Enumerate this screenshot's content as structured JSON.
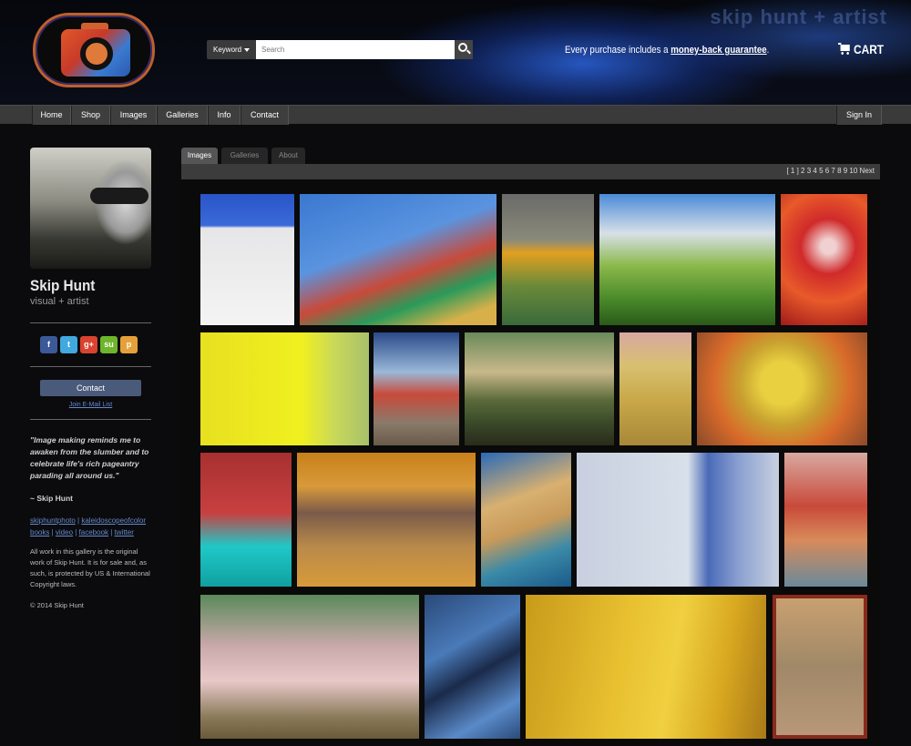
{
  "header": {
    "brand_watermark": "skip hunt + artist",
    "search": {
      "scope_label": "Keyword",
      "placeholder": "Search"
    },
    "promo_prefix": "Every purchase includes a",
    "promo_link": "money-back guarantee",
    "promo_suffix": ".",
    "cart_label": "CART"
  },
  "nav": {
    "items": [
      "Home",
      "Shop",
      "Images",
      "Galleries",
      "Info",
      "Contact"
    ],
    "signin": "Sign In"
  },
  "sidebar": {
    "name": "Skip Hunt",
    "subtitle": "visual + artist",
    "social": [
      "f",
      "t",
      "g+",
      "su",
      "p"
    ],
    "contact_label": "Contact",
    "join_label": "Join E-Mail List",
    "quote": "\"Image making reminds me to awaken from the slumber and to celebrate life's rich pageantry parading all around us.\"",
    "signature": "~ Skip Hunt",
    "links": {
      "l1": "skiphuntphoto",
      "sep1": " | ",
      "l2": "kaleidoscopeofcolor books",
      "sep2": " | ",
      "l3": "video",
      "sep3": " | ",
      "l4": "facebook",
      "sep4": " | ",
      "l5": "twitter"
    },
    "notice": "All work in this gallery is the original work of Skip Hunt. It is for sale and, as such, is protected by US & International Copyright laws.",
    "copyright": "© 2014 Skip Hunt"
  },
  "tabs": [
    "Images",
    "Galleries",
    "About"
  ],
  "pager": "[ 1 ] 2 3 4 5 6 7 8 9 10 Next",
  "colors": {
    "facebook": "#3b5998",
    "twitter": "#41a9e0",
    "googleplus": "#d9432f",
    "stumbleupon": "#6fb52c",
    "pinterest": "#e6a03a",
    "accent_link": "#6688cc"
  }
}
